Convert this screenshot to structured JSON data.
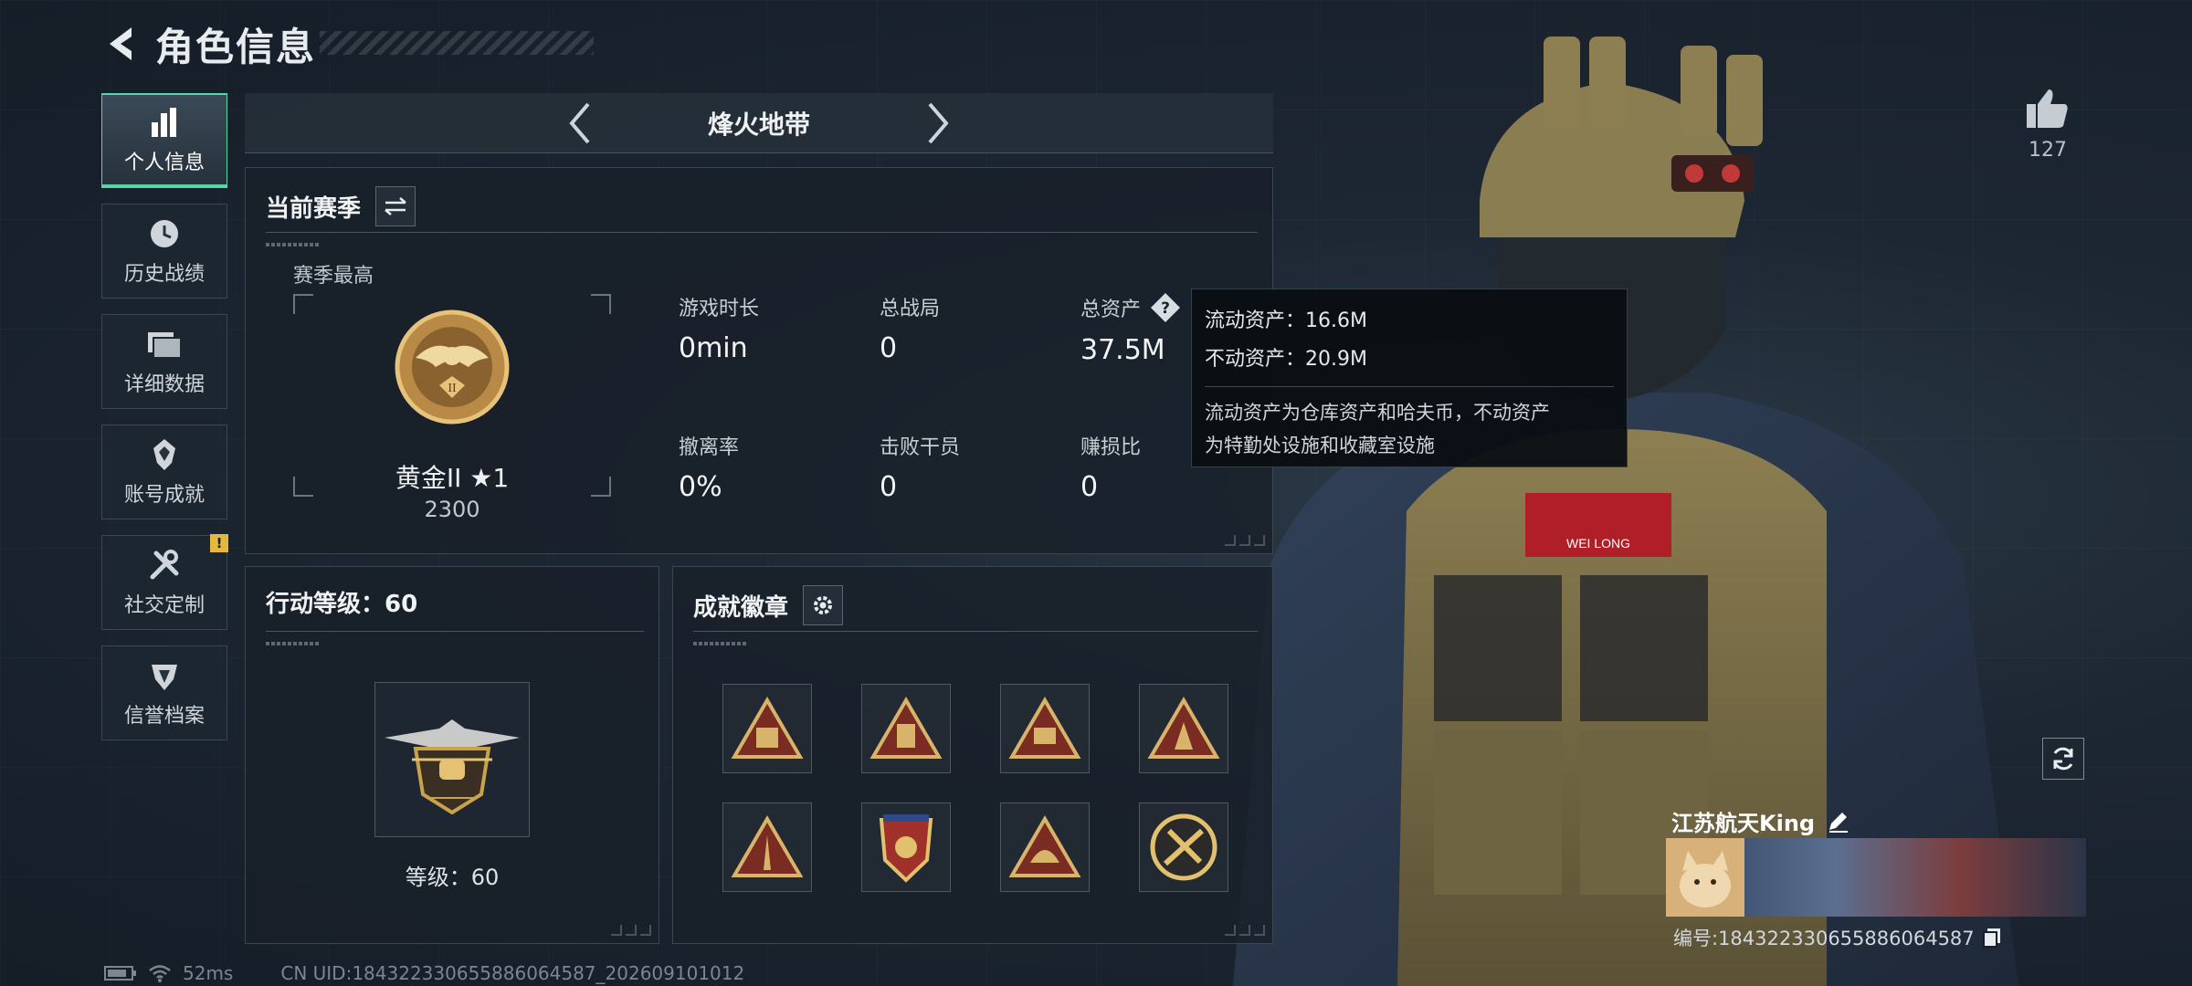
{
  "header": {
    "title": "角色信息"
  },
  "sidebar": {
    "items": [
      {
        "label": "个人信息",
        "icon": "bar-chart-icon"
      },
      {
        "label": "历史战绩",
        "icon": "clock-icon"
      },
      {
        "label": "详细数据",
        "icon": "folder-icon"
      },
      {
        "label": "账号成就",
        "icon": "achievement-icon"
      },
      {
        "label": "社交定制",
        "icon": "tools-icon",
        "badge": "!"
      },
      {
        "label": "信誉档案",
        "icon": "shield-icon"
      }
    ]
  },
  "mode": {
    "title": "烽火地带"
  },
  "season": {
    "title": "当前赛季",
    "best_label": "赛季最高",
    "rank_name": "黄金II ★1",
    "rank_score": "2300",
    "stats": [
      {
        "label": "游戏时长",
        "value": "0min"
      },
      {
        "label": "总战局",
        "value": "0"
      },
      {
        "label": "总资产",
        "value": "37.5M"
      },
      {
        "label": "撤离率",
        "value": "0%"
      },
      {
        "label": "击败干员",
        "value": "0"
      },
      {
        "label": "赚损比",
        "value": "0"
      }
    ]
  },
  "tooltip": {
    "liquid": "流动资产：16.6M",
    "fixed": "不动资产：20.9M",
    "desc_line1": "流动资产为仓库资产和哈夫币，不动资产",
    "desc_line2": "为特勤处设施和收藏室设施"
  },
  "level": {
    "title": "行动等级：60",
    "text": "等级：60"
  },
  "achievements": {
    "title": "成就徽章",
    "badges": [
      "badge-95",
      "badge-64",
      "badge-58",
      "badge-soldier",
      "badge-rocket",
      "badge-crest",
      "badge-helmet",
      "badge-emblem"
    ]
  },
  "likes": {
    "count": "127"
  },
  "player": {
    "name": "江苏航天King",
    "id": "编号:1843223306558860645​87"
  },
  "footer": {
    "ping": "52ms",
    "uid": "CN UID:1843223306558860645​87_202609101012"
  },
  "colors": {
    "accent": "#58d6a8",
    "gold": "#c9a24a",
    "warn": "#e3b93d"
  }
}
